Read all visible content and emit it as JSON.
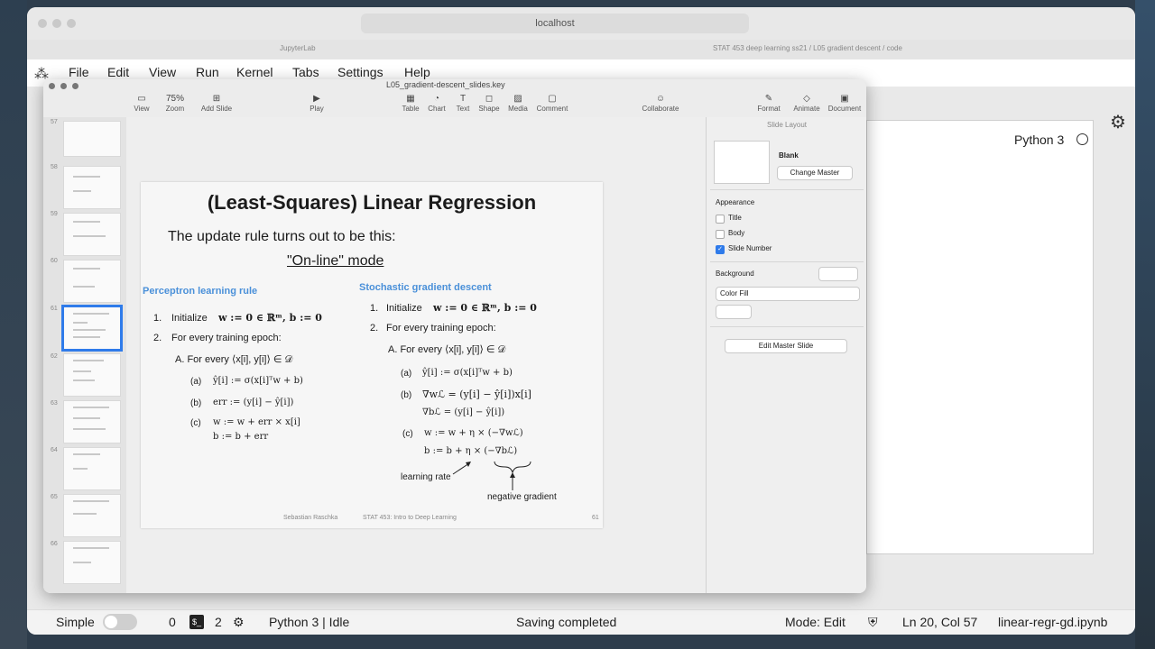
{
  "browser": {
    "url": "localhost",
    "tab_title": "JupyterLab",
    "github_tab": "STAT 453 deep learning ss21 / L05 gradient descent / code"
  },
  "jupyter": {
    "menu": [
      "File",
      "Edit",
      "View",
      "Run",
      "Kernel",
      "Tabs",
      "Settings",
      "Help"
    ],
    "kernel_name": "Python 3",
    "status": {
      "mode_label": "Simple",
      "zero_count": "0",
      "terminal_count": "2",
      "kernel_status": "Python 3 | Idle",
      "saving": "Saving completed",
      "mode": "Mode: Edit",
      "position": "Ln 20, Col 57",
      "filename": "linear-regr-gd.ipynb"
    }
  },
  "keynote": {
    "file_title": "L05_gradient-descent_slides.key",
    "zoom": "75%",
    "toolbar": {
      "view": "View",
      "zoom": "Zoom",
      "add_slide": "Add Slide",
      "play": "Play",
      "table": "Table",
      "chart": "Chart",
      "text": "Text",
      "shape": "Shape",
      "media": "Media",
      "comment": "Comment",
      "collaborate": "Collaborate",
      "format": "Format",
      "animate": "Animate",
      "document": "Document"
    },
    "thumb_numbers": [
      "57",
      "58",
      "59",
      "60",
      "61",
      "62",
      "63",
      "64",
      "65",
      "66"
    ],
    "inspector": {
      "header": "Slide Layout",
      "master_name": "Blank",
      "change_master": "Change Master",
      "appearance": "Appearance",
      "title": "Title",
      "body": "Body",
      "slide_number": "Slide Number",
      "background": "Background",
      "color_fill": "Color Fill",
      "edit_master": "Edit Master Slide"
    }
  },
  "slide": {
    "title": "(Least-Squares) Linear Regression",
    "subtitle": "The update rule turns out to be this:",
    "online": "\"On-line\" mode",
    "left_head": "Perceptron learning rule",
    "right_head": "Stochastic gradient descent",
    "l1_num": "1.",
    "l1_text": "Initialize",
    "l1_math": "w := 0 ∈ ℝᵐ, b := 0",
    "l2_num": "2.",
    "l2_text": "For every training epoch:",
    "lA_text": "A.   For every ⟨x[i], y[i]⟩ ∈ 𝒟",
    "la_lbl": "(a)",
    "la_math": "ŷ[i] := σ(x[i]ᵀw + b)",
    "lb_lbl": "(b)",
    "lb_math": "err := (y[i] − ŷ[i])",
    "lc_lbl": "(c)",
    "lc_math1": "w := w + err × x[i]",
    "lc_math2": "b := b + err",
    "r1_num": "1.",
    "r1_text": "Initialize",
    "r1_math": "w := 0 ∈ ℝᵐ, b := 0",
    "r2_num": "2.",
    "r2_text": "For every training epoch:",
    "rA_text": "A.   For every ⟨x[i], y[i]⟩ ∈ 𝒟",
    "ra_lbl": "(a)",
    "ra_math": "ŷ[i] := σ(x[i]ᵀw + b)",
    "rb_lbl": "(b)",
    "rb_math1": "∇wℒ = (y[i] − ŷ[i])x[i]",
    "rb_math2": "∇bℒ = (y[i] − ŷ[i])",
    "rc_lbl": "(c)",
    "rc_math1": "w := w + η × (−∇wℒ)",
    "rc_math2": "b := b + η × (−∇bℒ)",
    "learning_rate": "learning rate",
    "negative_gradient": "negative gradient",
    "footer_author": "Sebastian Raschka",
    "footer_course": "STAT 453: Intro to Deep Learning",
    "footer_page": "61"
  }
}
